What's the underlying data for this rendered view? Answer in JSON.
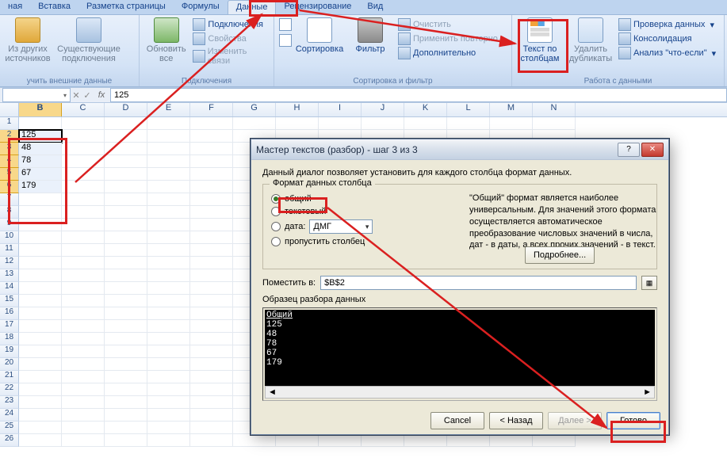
{
  "tabs": {
    "t0": "ная",
    "t1": "Вставка",
    "t2": "Разметка страницы",
    "t3": "Формулы",
    "t4": "Данные",
    "t5": "Рецензирование",
    "t6": "Вид"
  },
  "ribbon": {
    "group1": {
      "btn_other": "Из других источников",
      "btn_conn": "Существующие подключения",
      "title": "учить внешние данные"
    },
    "group2": {
      "btn_refresh": "Обновить все",
      "m_connections": "Подключения",
      "m_properties": "Свойства",
      "m_editlinks": "Изменить связи",
      "title": "Подключения"
    },
    "group3": {
      "sort_az": "А↓Я",
      "sort_za": "Я↓А",
      "sort_btn": "Сортировка",
      "filter_btn": "Фильтр",
      "m_clear": "Очистить",
      "m_reapply": "Применить повторно",
      "m_adv": "Дополнительно",
      "title": "Сортировка и фильтр"
    },
    "group4": {
      "btn_ttc1": "Текст по",
      "btn_ttc2": "столбцам",
      "btn_dup1": "Удалить",
      "btn_dup2": "дубликаты",
      "m_validate": "Проверка данных",
      "m_consol": "Консолидация",
      "m_whatif": "Анализ \"что-если\"",
      "title": "Работа с данными"
    }
  },
  "formula_bar": {
    "namebox": "",
    "fx": "fx",
    "value": "125"
  },
  "columns": [
    "B",
    "C",
    "D",
    "E",
    "F",
    "G",
    "H",
    "I",
    "J",
    "K",
    "L",
    "M",
    "N"
  ],
  "rows": [
    1,
    2,
    3,
    4,
    5,
    6,
    7,
    8,
    9,
    10,
    11,
    12,
    13,
    14,
    15,
    16,
    17,
    18,
    19,
    20,
    21,
    22,
    23,
    24,
    25,
    26
  ],
  "data_col_b": [
    "125",
    "48",
    "78",
    "67",
    "179"
  ],
  "dialog": {
    "title": "Мастер текстов (разбор) - шаг 3 из 3",
    "desc": "Данный диалог позволяет установить для каждого столбца формат данных.",
    "fieldset_legend": "Формат данных столбца",
    "opt_general": "общий",
    "opt_text": "текстовый",
    "opt_date": "дата:",
    "date_fmt": "ДМГ",
    "opt_skip": "пропустить столбец",
    "help": "\"Общий\" формат является наиболее универсальным. Для значений этого формата осуществляется автоматическое преобразование числовых значений в числа, дат - в даты, а всех прочих значений - в текст.",
    "btn_more": "Подробнее...",
    "place_label": "Поместить в:",
    "place_value": "$B$2",
    "preview_label": "Образец разбора данных",
    "preview_header": "Общий",
    "preview_rows": [
      "125",
      "48",
      "78",
      "67",
      "179"
    ],
    "btn_cancel": "Cancel",
    "btn_back": "< Назад",
    "btn_next": "Далее >",
    "btn_finish": "Готово"
  }
}
